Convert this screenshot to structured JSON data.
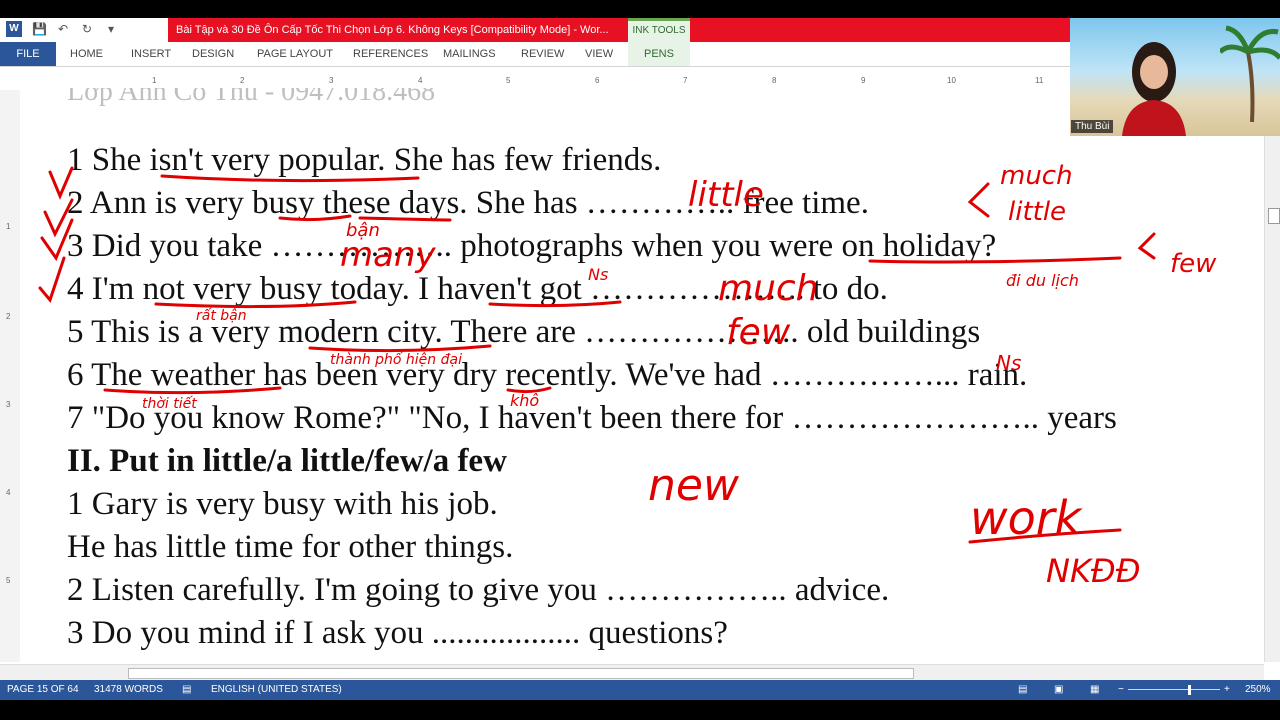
{
  "window": {
    "title": "Bài Tập và 30 Đề Ôn Cấp Tốc Thi Chọn Lớp 6. Không Keys [Compatibility Mode] - Wor...",
    "contextual_group": "INK TOOLS"
  },
  "ribbon": {
    "file": "FILE",
    "tabs": [
      "HOME",
      "INSERT",
      "DESIGN",
      "PAGE LAYOUT",
      "REFERENCES",
      "MAILINGS",
      "REVIEW",
      "VIEW"
    ],
    "pens": "PENS"
  },
  "ruler": {
    "ticks": [
      "1",
      "2",
      "3",
      "4",
      "5",
      "6",
      "7",
      "8",
      "9",
      "10",
      "11"
    ],
    "vticks": [
      "1",
      "2",
      "3",
      "4",
      "5"
    ]
  },
  "document": {
    "header": "Lớp Anh Cô Thu - 0947.018.468",
    "lines": [
      "1 She isn't very popular. She has few friends.",
      "2 Ann is very busy these days. She has ………….. free time.",
      "3 Did you take …………….. photographs when you were on holiday?",
      "4 I'm not very busy today. I haven't got ……………….. to do.",
      "5 This is a very modern city. There are ……………….. old buildings",
      "6 The weather has been very dry recently. We've had ……………... rain.",
      "7 \"Do you know Rome?\" \"No, I haven't been there for ………………….. years",
      "II. Put in little/a little/few/a few",
      "1 Gary is very busy with his job.",
      "He has little time for other things.",
      "2 Listen carefully. I'm going to give you …………….. advice.",
      "3 Do you mind if I ask you .................. questions?"
    ]
  },
  "ink": {
    "color": "#e00000",
    "words": [
      "little",
      "much",
      "little",
      "many",
      "few",
      "much",
      "few",
      "new",
      "work",
      "NKĐĐ",
      "bận",
      "Ns",
      "đi du lịch",
      "rất bận",
      "thành phố hiện đại",
      "thời tiết",
      "khô",
      "Ns"
    ]
  },
  "video": {
    "name": "Thu Bùi"
  },
  "status": {
    "page": "PAGE 15 OF 64",
    "words": "31478 WORDS",
    "language": "ENGLISH (UNITED STATES)",
    "zoom": "250%"
  },
  "colors": {
    "word_blue": "#2b579a",
    "title_red": "#e81123",
    "ink_red": "#e00000"
  }
}
